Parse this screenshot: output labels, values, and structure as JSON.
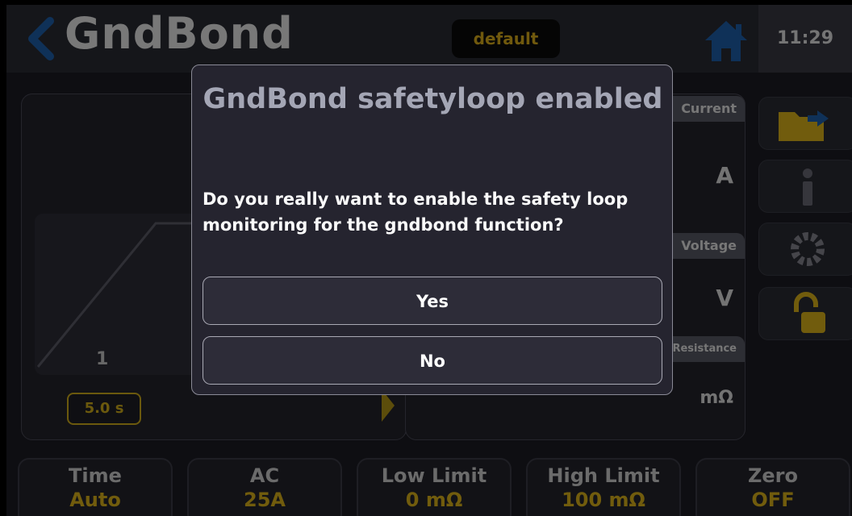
{
  "header": {
    "title": "GndBond",
    "profile": "default",
    "time": "11:29"
  },
  "panel_left": {
    "step_number": "1",
    "time_badge": "5.0 s"
  },
  "measurements": [
    {
      "tab": "Current",
      "unit": "A"
    },
    {
      "tab": "Voltage",
      "unit": "V"
    },
    {
      "tab": "Resistance",
      "unit": "mΩ"
    }
  ],
  "side_buttons": [
    "folder-export-icon",
    "info-icon",
    "gear-icon",
    "unlocked-padlock-icon"
  ],
  "params": [
    {
      "label": "Time",
      "value": "Auto"
    },
    {
      "label": "AC",
      "value": "25A"
    },
    {
      "label": "Low Limit",
      "value": "0 mΩ"
    },
    {
      "label": "High Limit",
      "value": "100 mΩ"
    },
    {
      "label": "Zero",
      "value": "OFF"
    }
  ],
  "dialog": {
    "title": "GndBond safetyloop enabled",
    "message": "Do you really want to enable the safety loop monitoring for the gndbond function?",
    "yes_label": "Yes",
    "no_label": "No"
  },
  "colors": {
    "accent": "#e2b81b",
    "icon_blue": "#1f63b0",
    "background": "#1c1c24"
  }
}
